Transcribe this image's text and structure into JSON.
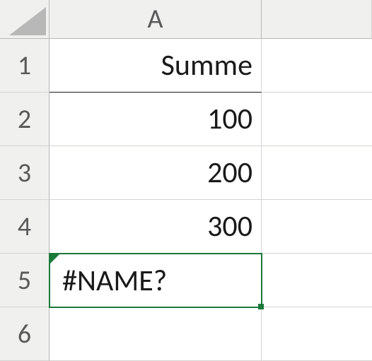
{
  "columns": {
    "A": "A"
  },
  "rows": {
    "1": "1",
    "2": "2",
    "3": "3",
    "4": "4",
    "5": "5",
    "6": "6"
  },
  "cells": {
    "A1": "Summe",
    "A2": "100",
    "A3": "200",
    "A4": "300",
    "A5": "#NAME?",
    "A6": ""
  },
  "selection": "A5",
  "chart_data": {
    "type": "table",
    "title": "Summe",
    "categories": [
      "A2",
      "A3",
      "A4"
    ],
    "values": [
      100,
      200,
      300
    ],
    "error_cell": {
      "ref": "A5",
      "value": "#NAME?"
    }
  }
}
